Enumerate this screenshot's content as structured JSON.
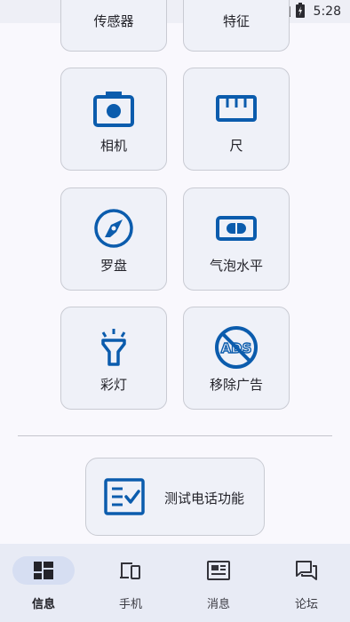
{
  "status_bar": {
    "time": "5:28",
    "icons": [
      "wifi-icon",
      "no-sim-icon",
      "battery-charging-icon"
    ]
  },
  "tools": [
    {
      "label": "传感器",
      "icon": "sensor-icon",
      "partial": true
    },
    {
      "label": "特征",
      "icon": "feature-icon",
      "partial": true
    },
    {
      "label": "相机",
      "icon": "camera-icon"
    },
    {
      "label": "尺",
      "icon": "ruler-icon"
    },
    {
      "label": "罗盘",
      "icon": "compass-icon"
    },
    {
      "label": "气泡水平",
      "icon": "bubble-level-icon"
    },
    {
      "label": "彩灯",
      "icon": "flashlight-icon"
    },
    {
      "label": "移除广告",
      "icon": "remove-ads-icon"
    }
  ],
  "test_card": {
    "label": "测试电话功能",
    "icon": "checklist-icon"
  },
  "bottom_nav": {
    "items": [
      {
        "label": "信息",
        "icon": "dashboard-icon",
        "active": true
      },
      {
        "label": "手机",
        "icon": "devices-icon"
      },
      {
        "label": "消息",
        "icon": "news-icon"
      },
      {
        "label": "论坛",
        "icon": "forum-icon"
      }
    ]
  },
  "colors": {
    "accent": "#0b5cad",
    "tile_bg": "#eff1f8",
    "nav_bg": "#e8ebf5",
    "nav_active_pill": "#d6def2"
  }
}
